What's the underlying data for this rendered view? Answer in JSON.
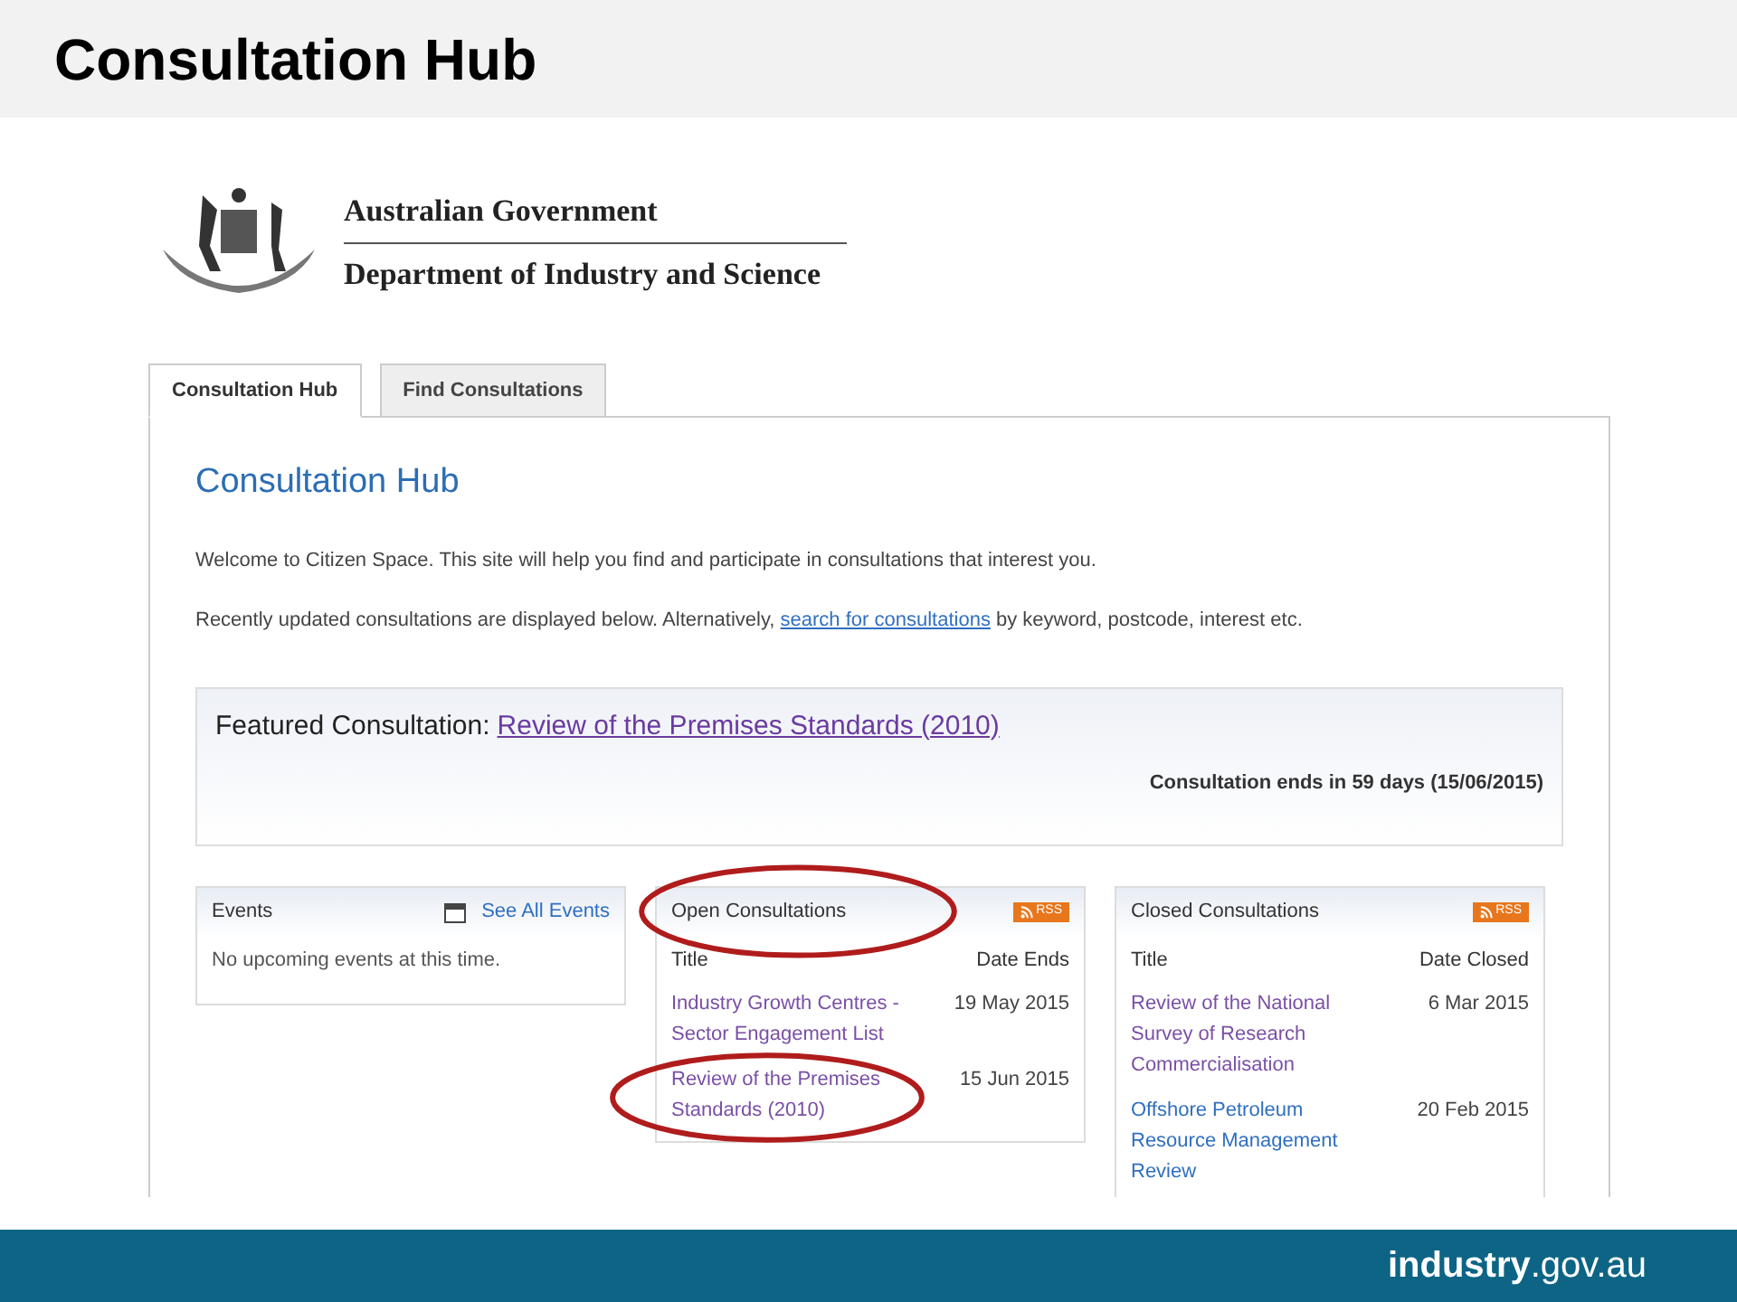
{
  "slide_title": "Consultation Hub",
  "header": {
    "line_1": "Australian Government",
    "line_2": "Department of Industry and Science"
  },
  "tabs": [
    {
      "label": "Consultation Hub",
      "selected": true
    },
    {
      "label": "Find Consultations",
      "selected": false
    }
  ],
  "page_heading": "Consultation Hub",
  "intro": "Welcome to Citizen Space. This site will help you find and participate in consultations that interest you.",
  "recent": {
    "before": "Recently updated consultations are displayed below. Alternatively, ",
    "link": "search for consultations",
    "after": " by keyword, postcode, interest etc."
  },
  "featured": {
    "label": "Featured Consultation:",
    "link": "Review of the Premises Standards (2010)",
    "ends": "Consultation ends in 59 days (15/06/2015)"
  },
  "events": {
    "title": "Events",
    "link": "See All Events",
    "empty": "No upcoming events at this time."
  },
  "open": {
    "title": "Open Consultations",
    "rss": "RSS",
    "columns": [
      "Title",
      "Date Ends"
    ],
    "highlighted": true,
    "rows": [
      {
        "title": "Industry Growth Centres - Sector Engagement List",
        "date": "19 May 2015",
        "visited": true,
        "highlighted": false
      },
      {
        "title": "Review of the Premises Standards (2010)",
        "date": "15 Jun 2015",
        "visited": true,
        "highlighted": true
      }
    ]
  },
  "closed": {
    "title": "Closed Consultations",
    "rss": "RSS",
    "columns": [
      "Title",
      "Date Closed"
    ],
    "highlighted": false,
    "rows": [
      {
        "title": "Review of the National Survey of Research Commercialisation",
        "date": "6 Mar 2015",
        "visited": true,
        "highlighted": false
      },
      {
        "title": "Offshore Petroleum Resource Management Review",
        "date": "20 Feb 2015",
        "visited": false,
        "highlighted": false
      }
    ]
  },
  "footer": {
    "site": "**industry**.gov.au"
  }
}
